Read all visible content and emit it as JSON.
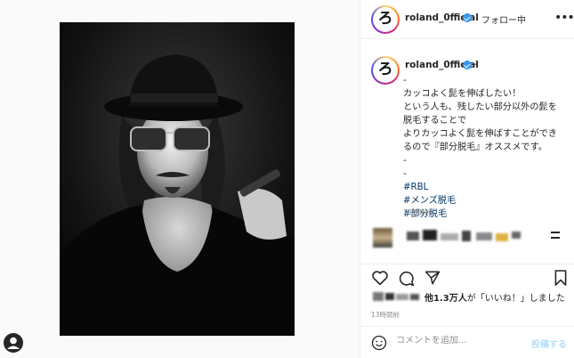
{
  "account": {
    "avatar_glyph": "ろ",
    "username": "roland_0fficial",
    "follow_status": "・フォロー中",
    "caption_suffix": "-"
  },
  "caption": {
    "lines": [
      "-",
      "カッコよく髭を伸ばしたい！",
      "という人も、残したい部分以外の髭を",
      "脱毛することで",
      "よりカッコよく髭を伸ばすことができ",
      "るので『部分脱毛』オススメです。",
      "-",
      "-"
    ],
    "hashtags": [
      "#RBL",
      "#メンズ脱毛",
      "#部分脱毛"
    ],
    "time": "13時間前"
  },
  "likes": {
    "count": "他1.3万人",
    "suffix": "が「いいね！」しました"
  },
  "post_time": "13時間前",
  "add_comment": {
    "placeholder": "コメントを追加...",
    "post_label": "投稿する"
  },
  "icons": {
    "more": "more-icon",
    "heart": "heart-icon",
    "comment": "comment-icon",
    "share": "share-icon",
    "save": "bookmark-icon",
    "emoji": "emoji-icon",
    "profile": "profile-icon"
  },
  "colors": {
    "verified": "#3897f0",
    "hashtag": "#00376b",
    "post_disabled": "#b2dffc"
  }
}
